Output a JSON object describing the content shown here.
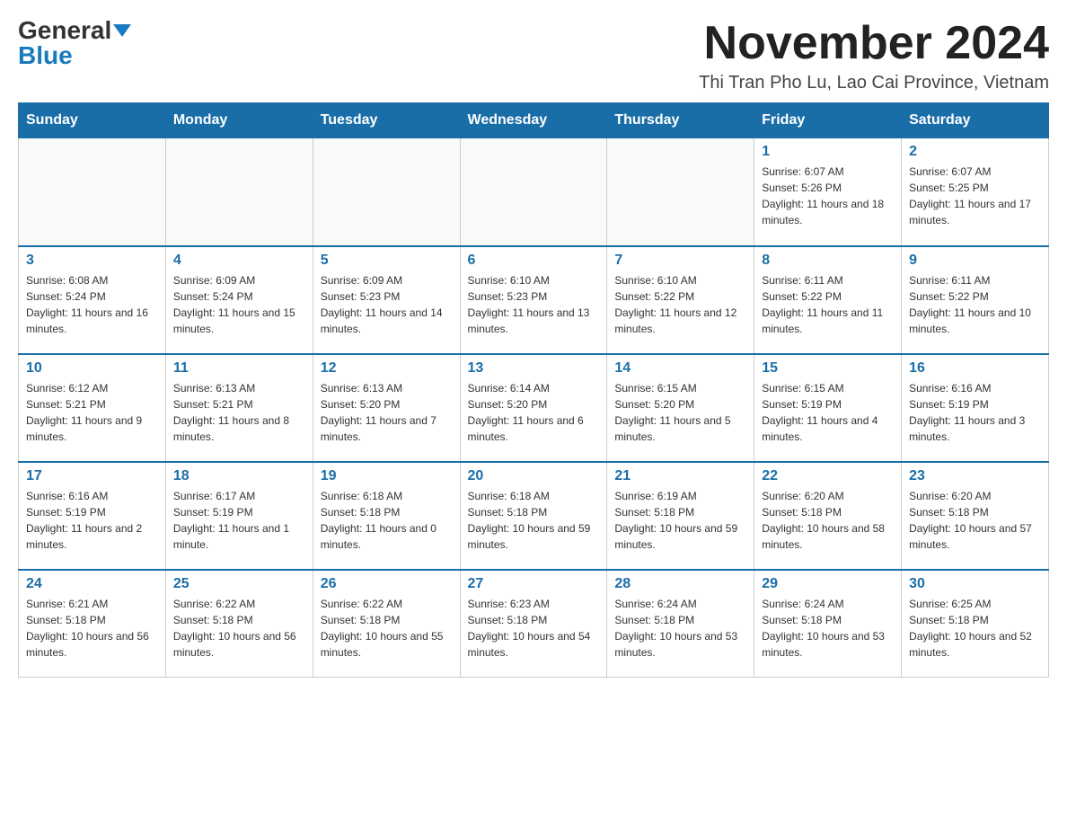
{
  "header": {
    "logo_general": "General",
    "logo_blue": "Blue",
    "month_title": "November 2024",
    "location": "Thi Tran Pho Lu, Lao Cai Province, Vietnam"
  },
  "weekdays": [
    "Sunday",
    "Monday",
    "Tuesday",
    "Wednesday",
    "Thursday",
    "Friday",
    "Saturday"
  ],
  "weeks": [
    [
      {
        "day": "",
        "info": ""
      },
      {
        "day": "",
        "info": ""
      },
      {
        "day": "",
        "info": ""
      },
      {
        "day": "",
        "info": ""
      },
      {
        "day": "",
        "info": ""
      },
      {
        "day": "1",
        "info": "Sunrise: 6:07 AM\nSunset: 5:26 PM\nDaylight: 11 hours and 18 minutes."
      },
      {
        "day": "2",
        "info": "Sunrise: 6:07 AM\nSunset: 5:25 PM\nDaylight: 11 hours and 17 minutes."
      }
    ],
    [
      {
        "day": "3",
        "info": "Sunrise: 6:08 AM\nSunset: 5:24 PM\nDaylight: 11 hours and 16 minutes."
      },
      {
        "day": "4",
        "info": "Sunrise: 6:09 AM\nSunset: 5:24 PM\nDaylight: 11 hours and 15 minutes."
      },
      {
        "day": "5",
        "info": "Sunrise: 6:09 AM\nSunset: 5:23 PM\nDaylight: 11 hours and 14 minutes."
      },
      {
        "day": "6",
        "info": "Sunrise: 6:10 AM\nSunset: 5:23 PM\nDaylight: 11 hours and 13 minutes."
      },
      {
        "day": "7",
        "info": "Sunrise: 6:10 AM\nSunset: 5:22 PM\nDaylight: 11 hours and 12 minutes."
      },
      {
        "day": "8",
        "info": "Sunrise: 6:11 AM\nSunset: 5:22 PM\nDaylight: 11 hours and 11 minutes."
      },
      {
        "day": "9",
        "info": "Sunrise: 6:11 AM\nSunset: 5:22 PM\nDaylight: 11 hours and 10 minutes."
      }
    ],
    [
      {
        "day": "10",
        "info": "Sunrise: 6:12 AM\nSunset: 5:21 PM\nDaylight: 11 hours and 9 minutes."
      },
      {
        "day": "11",
        "info": "Sunrise: 6:13 AM\nSunset: 5:21 PM\nDaylight: 11 hours and 8 minutes."
      },
      {
        "day": "12",
        "info": "Sunrise: 6:13 AM\nSunset: 5:20 PM\nDaylight: 11 hours and 7 minutes."
      },
      {
        "day": "13",
        "info": "Sunrise: 6:14 AM\nSunset: 5:20 PM\nDaylight: 11 hours and 6 minutes."
      },
      {
        "day": "14",
        "info": "Sunrise: 6:15 AM\nSunset: 5:20 PM\nDaylight: 11 hours and 5 minutes."
      },
      {
        "day": "15",
        "info": "Sunrise: 6:15 AM\nSunset: 5:19 PM\nDaylight: 11 hours and 4 minutes."
      },
      {
        "day": "16",
        "info": "Sunrise: 6:16 AM\nSunset: 5:19 PM\nDaylight: 11 hours and 3 minutes."
      }
    ],
    [
      {
        "day": "17",
        "info": "Sunrise: 6:16 AM\nSunset: 5:19 PM\nDaylight: 11 hours and 2 minutes."
      },
      {
        "day": "18",
        "info": "Sunrise: 6:17 AM\nSunset: 5:19 PM\nDaylight: 11 hours and 1 minute."
      },
      {
        "day": "19",
        "info": "Sunrise: 6:18 AM\nSunset: 5:18 PM\nDaylight: 11 hours and 0 minutes."
      },
      {
        "day": "20",
        "info": "Sunrise: 6:18 AM\nSunset: 5:18 PM\nDaylight: 10 hours and 59 minutes."
      },
      {
        "day": "21",
        "info": "Sunrise: 6:19 AM\nSunset: 5:18 PM\nDaylight: 10 hours and 59 minutes."
      },
      {
        "day": "22",
        "info": "Sunrise: 6:20 AM\nSunset: 5:18 PM\nDaylight: 10 hours and 58 minutes."
      },
      {
        "day": "23",
        "info": "Sunrise: 6:20 AM\nSunset: 5:18 PM\nDaylight: 10 hours and 57 minutes."
      }
    ],
    [
      {
        "day": "24",
        "info": "Sunrise: 6:21 AM\nSunset: 5:18 PM\nDaylight: 10 hours and 56 minutes."
      },
      {
        "day": "25",
        "info": "Sunrise: 6:22 AM\nSunset: 5:18 PM\nDaylight: 10 hours and 56 minutes."
      },
      {
        "day": "26",
        "info": "Sunrise: 6:22 AM\nSunset: 5:18 PM\nDaylight: 10 hours and 55 minutes."
      },
      {
        "day": "27",
        "info": "Sunrise: 6:23 AM\nSunset: 5:18 PM\nDaylight: 10 hours and 54 minutes."
      },
      {
        "day": "28",
        "info": "Sunrise: 6:24 AM\nSunset: 5:18 PM\nDaylight: 10 hours and 53 minutes."
      },
      {
        "day": "29",
        "info": "Sunrise: 6:24 AM\nSunset: 5:18 PM\nDaylight: 10 hours and 53 minutes."
      },
      {
        "day": "30",
        "info": "Sunrise: 6:25 AM\nSunset: 5:18 PM\nDaylight: 10 hours and 52 minutes."
      }
    ]
  ]
}
